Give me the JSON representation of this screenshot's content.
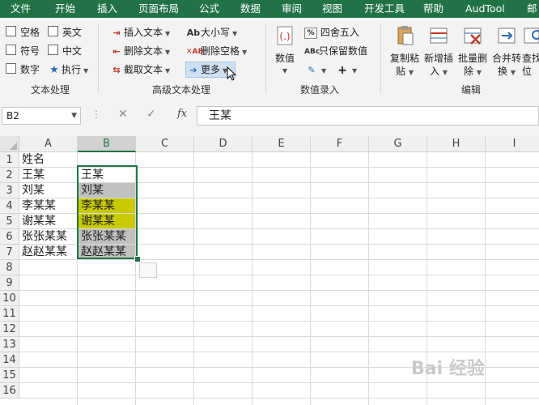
{
  "menu": [
    "文件",
    "开始",
    "插入",
    "页面布局",
    "公式",
    "数据",
    "审阅",
    "视图",
    "开发工具",
    "帮助",
    "AudTool",
    "邮"
  ],
  "ribbon": {
    "text_group": {
      "checkboxes": [
        "空格",
        "英文",
        "符号",
        "中文",
        "数字"
      ],
      "execute_label": "执行",
      "label": "文本处理"
    },
    "adv_group": {
      "buttons": [
        "插入文本",
        "删除文本",
        "截取文本",
        "大小写",
        "删除空格",
        "更多"
      ],
      "label": "高级文本处理"
    },
    "number_group": {
      "value_label": "数值",
      "round_label": "四舍五入",
      "keep_value_label": "只保留数值",
      "label": "数值录入"
    },
    "edit_group": {
      "buttons": [
        {
          "line1": "复制粘",
          "line2": "贴"
        },
        {
          "line1": "新增插",
          "line2": "入"
        },
        {
          "line1": "批量删",
          "line2": "除"
        },
        {
          "line1": "合并转",
          "line2": "换"
        },
        {
          "line1": "查找",
          "line2": "位"
        }
      ],
      "label": "编辑"
    }
  },
  "formula_bar": {
    "name_box": "B2",
    "formula": "王某",
    "fx": "fx"
  },
  "columns": [
    "A",
    "B",
    "C",
    "D",
    "E",
    "F",
    "G",
    "H",
    "I"
  ],
  "selected_column": "B",
  "rows": [
    "1",
    "2",
    "3",
    "4",
    "5",
    "6",
    "7",
    "8",
    "9",
    "10",
    "11",
    "12",
    "13",
    "14",
    "15",
    "16"
  ],
  "cells": {
    "A1": "姓名",
    "A2": "王某",
    "A3": "刘某",
    "A4": "李某某",
    "A5": "谢某某",
    "A6": "张张某某",
    "A7": "赵赵某某",
    "B2": "王某",
    "B3": "刘某",
    "B4": "李某某",
    "B5": "谢某某",
    "B6": "张张某某",
    "B7": "赵赵某某"
  },
  "cell_fills": {
    "B3": "#c0c0c0",
    "B4": "#c9c900",
    "B5": "#c9c900",
    "B6": "#c0c0c0",
    "B7": "#c0c0c0"
  },
  "colors": {
    "accent": "#217346"
  },
  "watermark": "Bai 经验"
}
